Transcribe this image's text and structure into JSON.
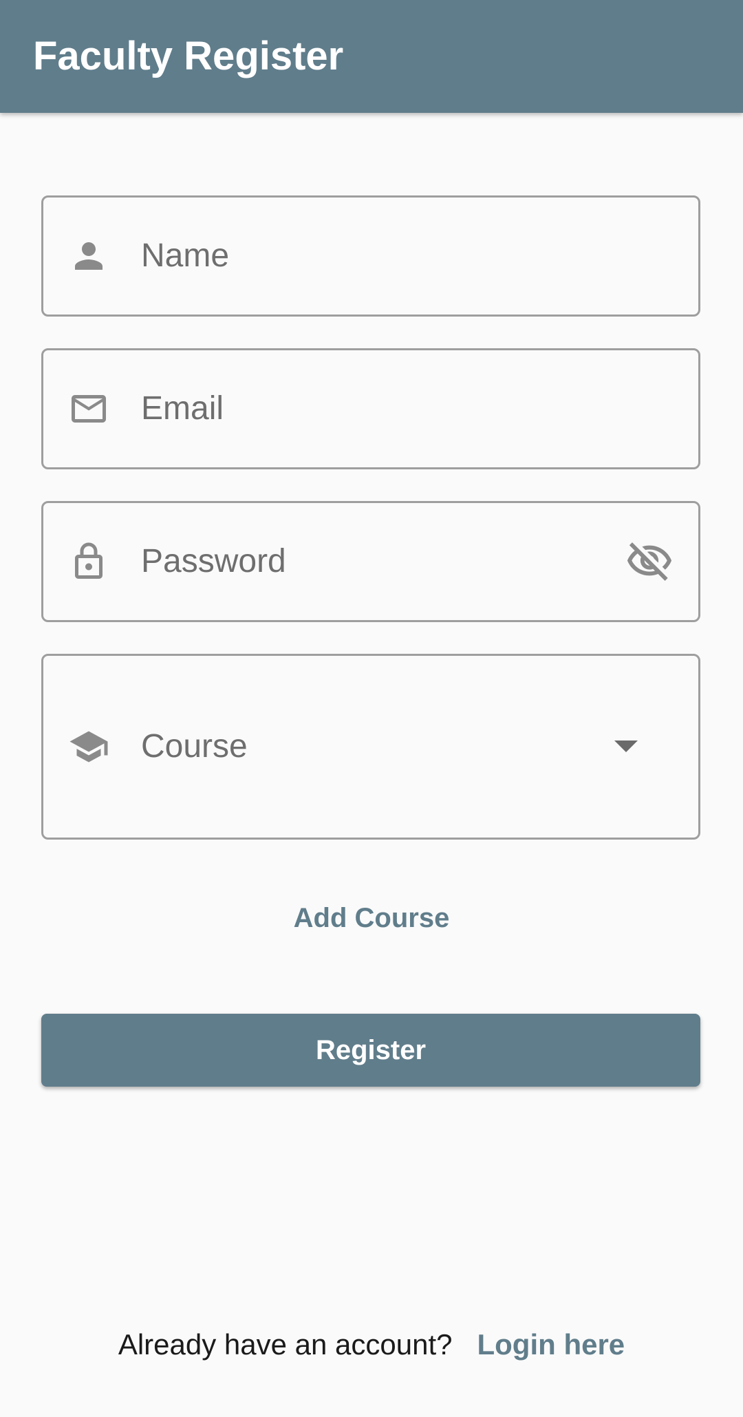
{
  "app_bar": {
    "title": "Faculty Register",
    "color": "#607D8B"
  },
  "form": {
    "name": {
      "placeholder": "Name",
      "icon": "person-icon"
    },
    "email": {
      "placeholder": "Email",
      "icon": "mail-icon"
    },
    "password": {
      "placeholder": "Password",
      "icon": "lock-icon",
      "toggle_icon": "visibility-off-icon"
    },
    "course": {
      "placeholder": "Course",
      "icon": "school-icon",
      "dropdown_icon": "arrow-drop-down-icon"
    }
  },
  "add_course_label": "Add Course",
  "register_label": "Register",
  "footer": {
    "question": "Already have an account?",
    "login_link": "Login here"
  },
  "colors": {
    "primary": "#607D8B",
    "background": "#FAFAFA",
    "border": "#9E9E9E",
    "icon": "#8A8A8A",
    "hint_text": "#6E6E6E"
  }
}
